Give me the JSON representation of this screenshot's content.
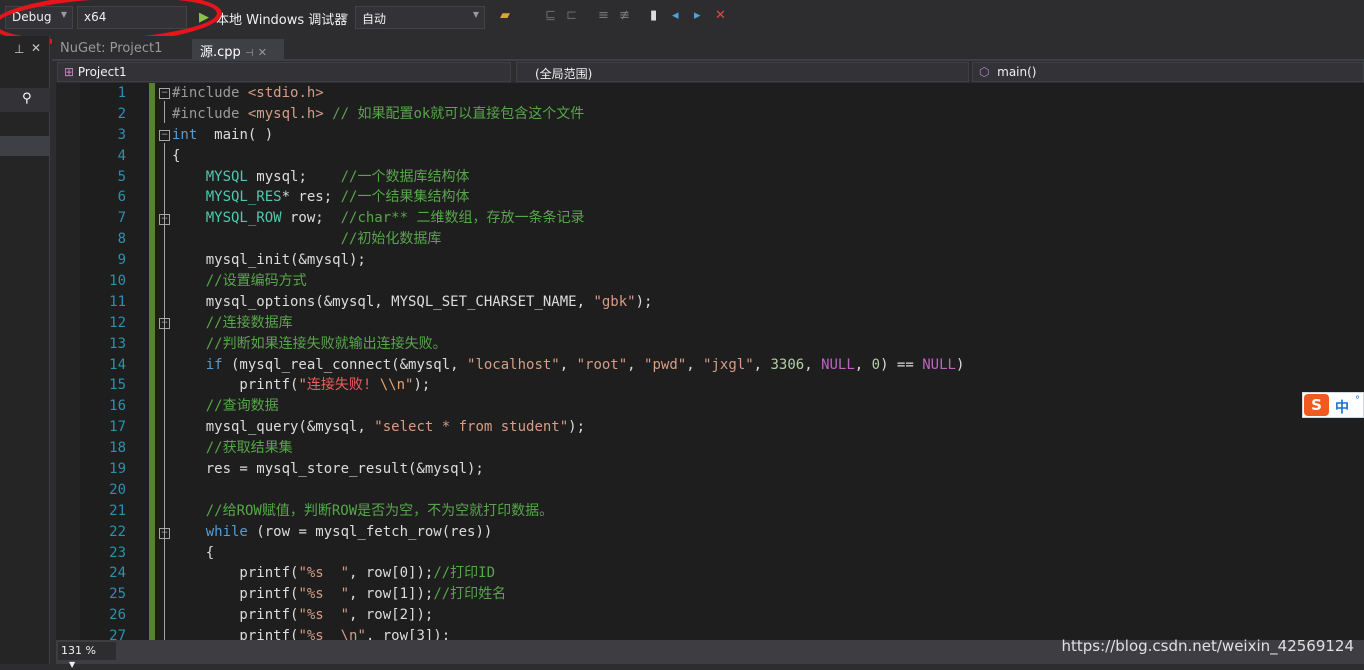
{
  "toolbar": {
    "config": "Debug",
    "platform": "x64",
    "debugger_label": "本地 Windows 调试器",
    "auto": "自动"
  },
  "tabs": [
    {
      "label": "NuGet: Project1"
    },
    {
      "label": "源.cpp"
    }
  ],
  "navbar": {
    "project": "Project1",
    "scope": "(全局范围)",
    "member": "main()"
  },
  "status": {
    "zoom": "131 %",
    "watermark": "https://blog.csdn.net/weixin_42569124"
  },
  "ime": {
    "label": "中"
  },
  "colors": {
    "keyword": "#569cd6",
    "type": "#4ec9b0",
    "comment": "#57a64a",
    "string": "#d69d85",
    "macro": "#bd63c5",
    "line_number": "#2b91af",
    "change_bar": "#57822f"
  },
  "code": [
    {
      "n": "1",
      "t": [
        [
          "pp",
          "#include"
        ],
        [
          "str",
          " <stdio.h>"
        ]
      ]
    },
    {
      "n": "2",
      "t": [
        [
          "pp",
          "#include"
        ],
        [
          "str",
          " <mysql.h>"
        ],
        [
          "cm",
          " // 如果配置ok就可以直接包含这个文件"
        ]
      ]
    },
    {
      "n": "3",
      "t": [
        [
          "kw",
          "int"
        ],
        [
          "",
          "  main( )"
        ]
      ]
    },
    {
      "n": "4",
      "t": [
        [
          "",
          "{"
        ]
      ]
    },
    {
      "n": "5",
      "t": [
        [
          "",
          "    "
        ],
        [
          "ty",
          "MYSQL"
        ],
        [
          "",
          " mysql;    "
        ],
        [
          "cm",
          "//一个数据库结构体"
        ]
      ]
    },
    {
      "n": "6",
      "t": [
        [
          "",
          "    "
        ],
        [
          "ty",
          "MYSQL_RES"
        ],
        [
          "",
          "* res; "
        ],
        [
          "cm",
          "//一个结果集结构体"
        ]
      ]
    },
    {
      "n": "7",
      "t": [
        [
          "",
          "    "
        ],
        [
          "ty",
          "MYSQL_ROW"
        ],
        [
          "",
          " row;  "
        ],
        [
          "cm",
          "//char** 二维数组，存放一条条记录"
        ]
      ]
    },
    {
      "n": "8",
      "t": [
        [
          "",
          "                    "
        ],
        [
          "cm",
          "//初始化数据库"
        ]
      ]
    },
    {
      "n": "9",
      "t": [
        [
          "",
          "    mysql_init(&mysql);"
        ]
      ]
    },
    {
      "n": "10",
      "t": [
        [
          "",
          "    "
        ],
        [
          "cm",
          "//设置编码方式"
        ]
      ]
    },
    {
      "n": "11",
      "t": [
        [
          "",
          "    mysql_options(&mysql, MYSQL_SET_CHARSET_NAME, "
        ],
        [
          "str",
          "\"gbk\""
        ],
        [
          "",
          ");"
        ]
      ]
    },
    {
      "n": "12",
      "t": [
        [
          "",
          "    "
        ],
        [
          "cm",
          "//连接数据库"
        ]
      ]
    },
    {
      "n": "13",
      "t": [
        [
          "",
          "    "
        ],
        [
          "cm",
          "//判断如果连接失败就输出连接失败。"
        ]
      ]
    },
    {
      "n": "14",
      "t": [
        [
          "",
          "    "
        ],
        [
          "kw",
          "if"
        ],
        [
          "",
          " (mysql_real_connect(&mysql, "
        ],
        [
          "str",
          "\"localhost\""
        ],
        [
          "",
          ", "
        ],
        [
          "str",
          "\"root\""
        ],
        [
          "",
          ", "
        ],
        [
          "str",
          "\"pwd\""
        ],
        [
          "",
          ", "
        ],
        [
          "str",
          "\"jxgl\""
        ],
        [
          "",
          ", "
        ],
        [
          "num",
          "3306"
        ],
        [
          "",
          ", "
        ],
        [
          "mac",
          "NULL"
        ],
        [
          "",
          ", "
        ],
        [
          "num",
          "0"
        ],
        [
          "",
          ") == "
        ],
        [
          "mac",
          "NULL"
        ],
        [
          "",
          ")"
        ]
      ]
    },
    {
      "n": "15",
      "t": [
        [
          "",
          "        printf("
        ],
        [
          "str",
          "\""
        ],
        [
          "err",
          "连接失败! "
        ],
        [
          "esc",
          "\\\\n"
        ],
        [
          "str",
          "\""
        ],
        [
          "",
          ");"
        ]
      ]
    },
    {
      "n": "16",
      "t": [
        [
          "",
          "    "
        ],
        [
          "cm",
          "//查询数据"
        ]
      ]
    },
    {
      "n": "17",
      "t": [
        [
          "",
          "    mysql_query(&mysql, "
        ],
        [
          "str",
          "\"select * from student\""
        ],
        [
          "",
          ");"
        ]
      ]
    },
    {
      "n": "18",
      "t": [
        [
          "",
          "    "
        ],
        [
          "cm",
          "//获取结果集"
        ]
      ]
    },
    {
      "n": "19",
      "t": [
        [
          "",
          "    res = mysql_store_result(&mysql);"
        ]
      ]
    },
    {
      "n": "20",
      "t": [
        [
          "",
          ""
        ]
      ]
    },
    {
      "n": "21",
      "t": [
        [
          "",
          "    "
        ],
        [
          "cm",
          "//给ROW赋值，判断ROW是否为空，不为空就打印数据。"
        ]
      ]
    },
    {
      "n": "22",
      "t": [
        [
          "",
          "    "
        ],
        [
          "kw",
          "while"
        ],
        [
          "",
          " (row = mysql_fetch_row(res))"
        ]
      ]
    },
    {
      "n": "23",
      "t": [
        [
          "",
          "    {"
        ]
      ]
    },
    {
      "n": "24",
      "t": [
        [
          "",
          "        printf("
        ],
        [
          "str",
          "\"%s  \""
        ],
        [
          "",
          ", row[0]);"
        ],
        [
          "cm",
          "//打印ID"
        ]
      ]
    },
    {
      "n": "25",
      "t": [
        [
          "",
          "        printf("
        ],
        [
          "str",
          "\"%s  \""
        ],
        [
          "",
          ", row[1]);"
        ],
        [
          "cm",
          "//打印姓名"
        ]
      ]
    },
    {
      "n": "26",
      "t": [
        [
          "",
          "        printf("
        ],
        [
          "str",
          "\"%s  \""
        ],
        [
          "",
          ", row[2]);"
        ]
      ]
    },
    {
      "n": "27",
      "t": [
        [
          "",
          "        printf("
        ],
        [
          "str",
          "\"%s  \\n\""
        ],
        [
          "",
          ", row[3]);"
        ]
      ]
    }
  ]
}
